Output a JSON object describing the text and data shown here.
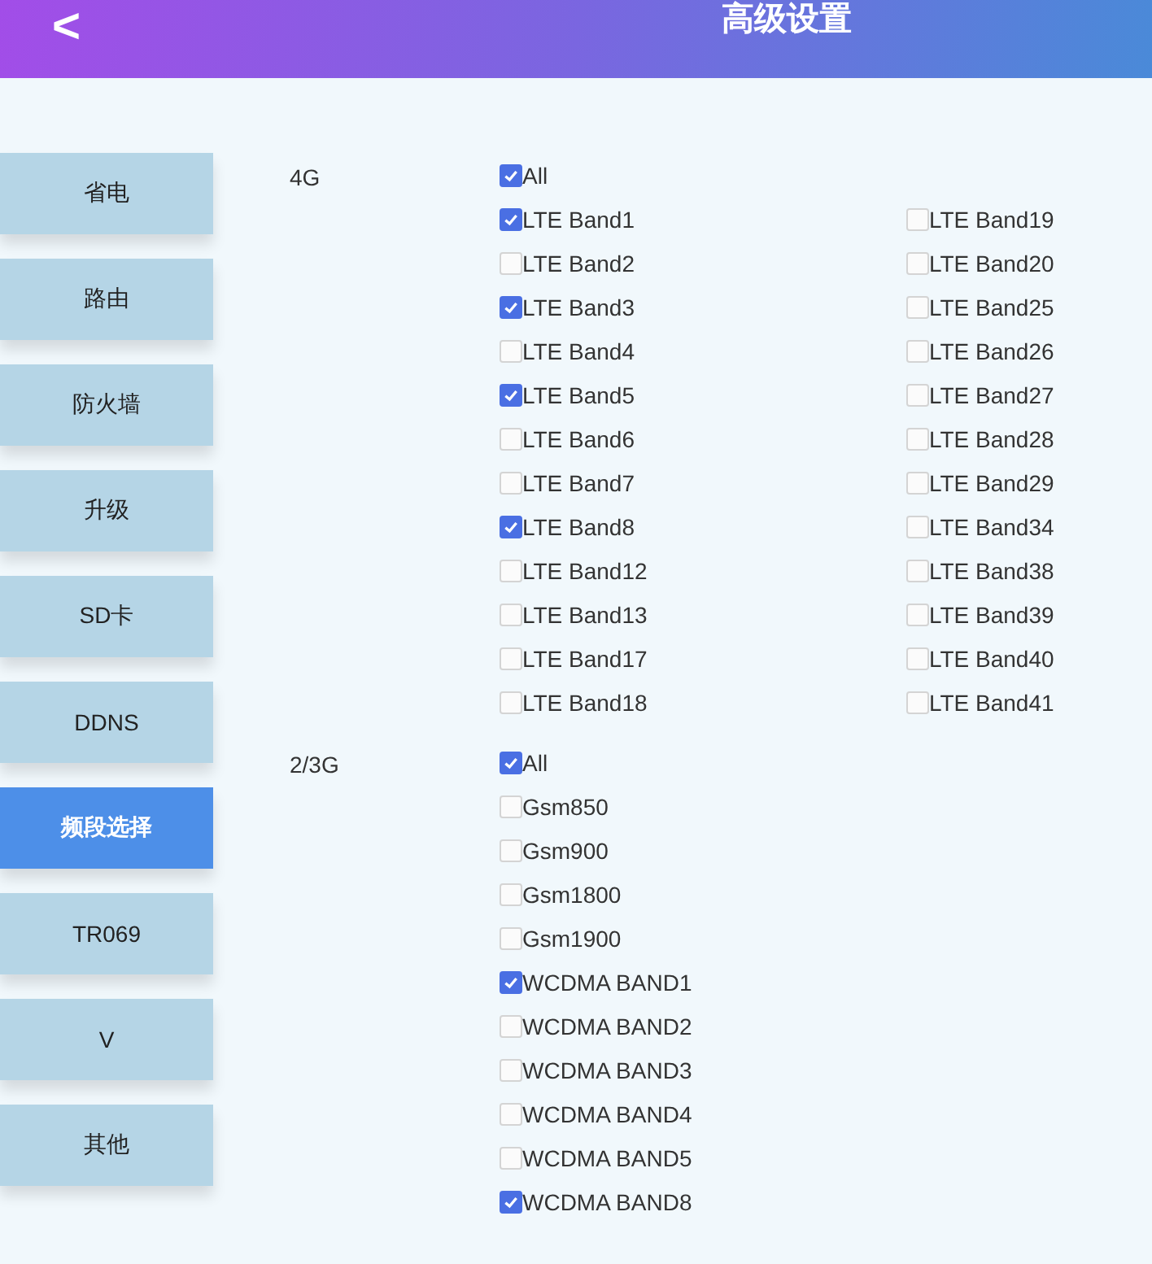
{
  "header": {
    "back": "<",
    "title": "高级设置"
  },
  "sidebar": {
    "items": [
      {
        "label": "省电",
        "selected": false
      },
      {
        "label": "路由",
        "selected": false
      },
      {
        "label": "防火墙",
        "selected": false
      },
      {
        "label": "升级",
        "selected": false
      },
      {
        "label": "SD卡",
        "selected": false
      },
      {
        "label": "DDNS",
        "selected": false
      },
      {
        "label": "频段选择",
        "selected": true
      },
      {
        "label": "TR069",
        "selected": false
      },
      {
        "label": "V",
        "selected": false
      },
      {
        "label": "其他",
        "selected": false
      }
    ]
  },
  "sections": [
    {
      "label": "4G",
      "all": {
        "label": "All",
        "checked": true
      },
      "columns": [
        [
          {
            "label": "LTE Band1",
            "checked": true
          },
          {
            "label": "LTE Band2",
            "checked": false
          },
          {
            "label": "LTE Band3",
            "checked": true
          },
          {
            "label": "LTE Band4",
            "checked": false
          },
          {
            "label": "LTE Band5",
            "checked": true
          },
          {
            "label": "LTE Band6",
            "checked": false
          },
          {
            "label": "LTE Band7",
            "checked": false
          },
          {
            "label": "LTE Band8",
            "checked": true
          },
          {
            "label": "LTE Band12",
            "checked": false
          },
          {
            "label": "LTE Band13",
            "checked": false
          },
          {
            "label": "LTE Band17",
            "checked": false
          },
          {
            "label": "LTE Band18",
            "checked": false
          }
        ],
        [
          {
            "label": "LTE Band19",
            "checked": false
          },
          {
            "label": "LTE Band20",
            "checked": false
          },
          {
            "label": "LTE Band25",
            "checked": false
          },
          {
            "label": "LTE Band26",
            "checked": false
          },
          {
            "label": "LTE Band27",
            "checked": false
          },
          {
            "label": "LTE Band28",
            "checked": false
          },
          {
            "label": "LTE Band29",
            "checked": false
          },
          {
            "label": "LTE Band34",
            "checked": false
          },
          {
            "label": "LTE Band38",
            "checked": false
          },
          {
            "label": "LTE Band39",
            "checked": false
          },
          {
            "label": "LTE Band40",
            "checked": false
          },
          {
            "label": "LTE Band41",
            "checked": false
          }
        ]
      ]
    },
    {
      "label": "2/3G",
      "all": {
        "label": "All",
        "checked": true
      },
      "columns": [
        [
          {
            "label": "Gsm850",
            "checked": false
          },
          {
            "label": "Gsm900",
            "checked": false
          },
          {
            "label": "Gsm1800",
            "checked": false
          },
          {
            "label": "Gsm1900",
            "checked": false
          },
          {
            "label": "WCDMA BAND1",
            "checked": true
          },
          {
            "label": "WCDMA BAND2",
            "checked": false
          },
          {
            "label": "WCDMA BAND3",
            "checked": false
          },
          {
            "label": "WCDMA BAND4",
            "checked": false
          },
          {
            "label": "WCDMA BAND5",
            "checked": false
          },
          {
            "label": "WCDMA BAND8",
            "checked": true
          }
        ]
      ]
    }
  ]
}
